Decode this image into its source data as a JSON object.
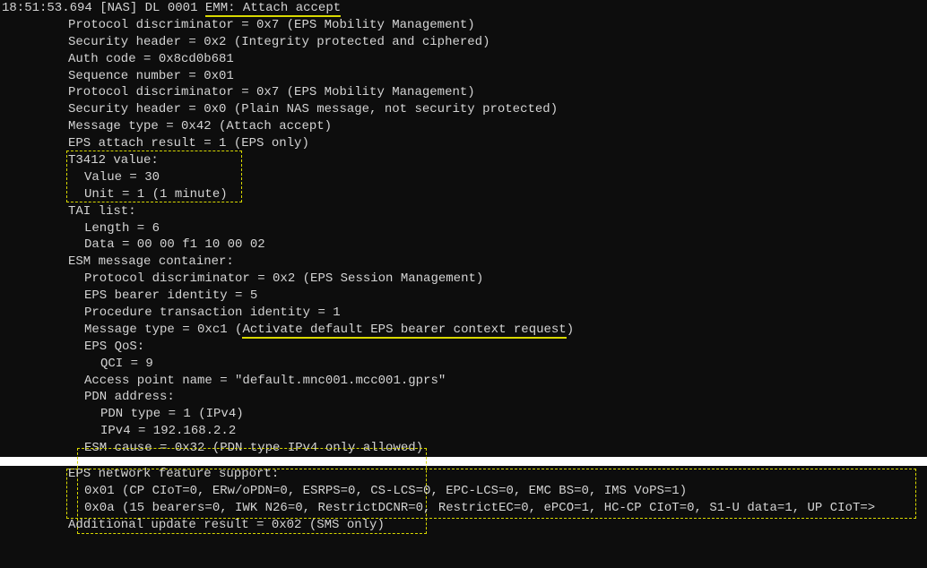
{
  "header": {
    "timestamp": "18:51:53.694",
    "tag": "[NAS]",
    "direction": "DL",
    "seq": "0001",
    "title": "EMM: Attach accept"
  },
  "fields": {
    "protocol_disc1": "Protocol discriminator = 0x7 (EPS Mobility Management)",
    "sec_header1": "Security header = 0x2 (Integrity protected and ciphered)",
    "auth_code": "Auth code = 0x8cd0b681",
    "seq_num": "Sequence number = 0x01",
    "protocol_disc2": "Protocol discriminator = 0x7 (EPS Mobility Management)",
    "sec_header2": "Security header = 0x0 (Plain NAS message, not security protected)",
    "msg_type": "Message type = 0x42 (Attach accept)",
    "attach_result": "EPS attach result = 1 (EPS only)",
    "t3412_label": "T3412 value:",
    "t3412_value": "Value = 30",
    "t3412_unit": "Unit = 1 (1 minute)",
    "tai_label": "TAI list:",
    "tai_length": "Length = 6",
    "tai_data": "Data = 00 00 f1 10 00 02",
    "esm_label": "ESM message container:",
    "esm_protocol": "Protocol discriminator = 0x2 (EPS Session Management)",
    "esm_bearer": "EPS bearer identity = 5",
    "esm_proc": "Procedure transaction identity = 1",
    "esm_msg_prefix": "Message type = 0xc1 (",
    "esm_msg_highlight": "Activate default EPS bearer context request",
    "esm_msg_suffix": ")",
    "eps_qos_label": "EPS QoS:",
    "qci": "QCI = 9",
    "apn": "Access point name = \"default.mnc001.mcc001.gprs\"",
    "pdn_label": "PDN address:",
    "pdn_type": "PDN type = 1 (IPv4)",
    "pdn_ipv4": "IPv4 = 192.168.2.2",
    "esm_cause": "ESM cause = 0x32 (PDN type IPv4 only allowed)"
  },
  "footer": {
    "eps_label": "EPS network feature support:",
    "eps_line1": "0x01 (CP CIoT=0, ERw/oPDN=0, ESRPS=0, CS-LCS=0, EPC-LCS=0, EMC BS=0, IMS VoPS=1)",
    "eps_line2": "0x0a (15 bearers=0, IWK N26=0, RestrictDCNR=0, RestrictEC=0, ePCO=1, HC-CP CIoT=0, S1-U data=1, UP CIoT=>",
    "additional": "Additional update result = 0x02 (SMS only)"
  }
}
